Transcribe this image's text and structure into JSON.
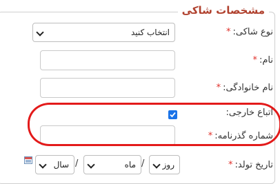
{
  "section": {
    "title": "مشخصات شاکی"
  },
  "fields": {
    "complainant_type": {
      "label": "نوع شاکی:",
      "required_mark": "*",
      "value": "انتخاب کنید"
    },
    "first_name": {
      "label": "نام:",
      "required_mark": "*",
      "value": ""
    },
    "last_name": {
      "label": "نام خانوادگی:",
      "required_mark": "*",
      "value": ""
    },
    "foreign_national": {
      "label": "اتباع خارجی:",
      "checked": true
    },
    "passport_number": {
      "label": "شماره گذرنامه:",
      "required_mark": "*",
      "value": ""
    },
    "birth_date": {
      "label": "تاریخ تولد:",
      "required_mark": "*",
      "day": "روز",
      "month": "ماه",
      "year": "سال",
      "separator": "/"
    }
  },
  "colors": {
    "title": "#b0412e",
    "required": "#e0302a",
    "checkbox": "#1a73e8",
    "highlight": "#e31a1a"
  },
  "icons": {
    "calendar": "calendar-icon",
    "checkbox": "check-icon",
    "dropdown": "chevron-down-icon"
  }
}
